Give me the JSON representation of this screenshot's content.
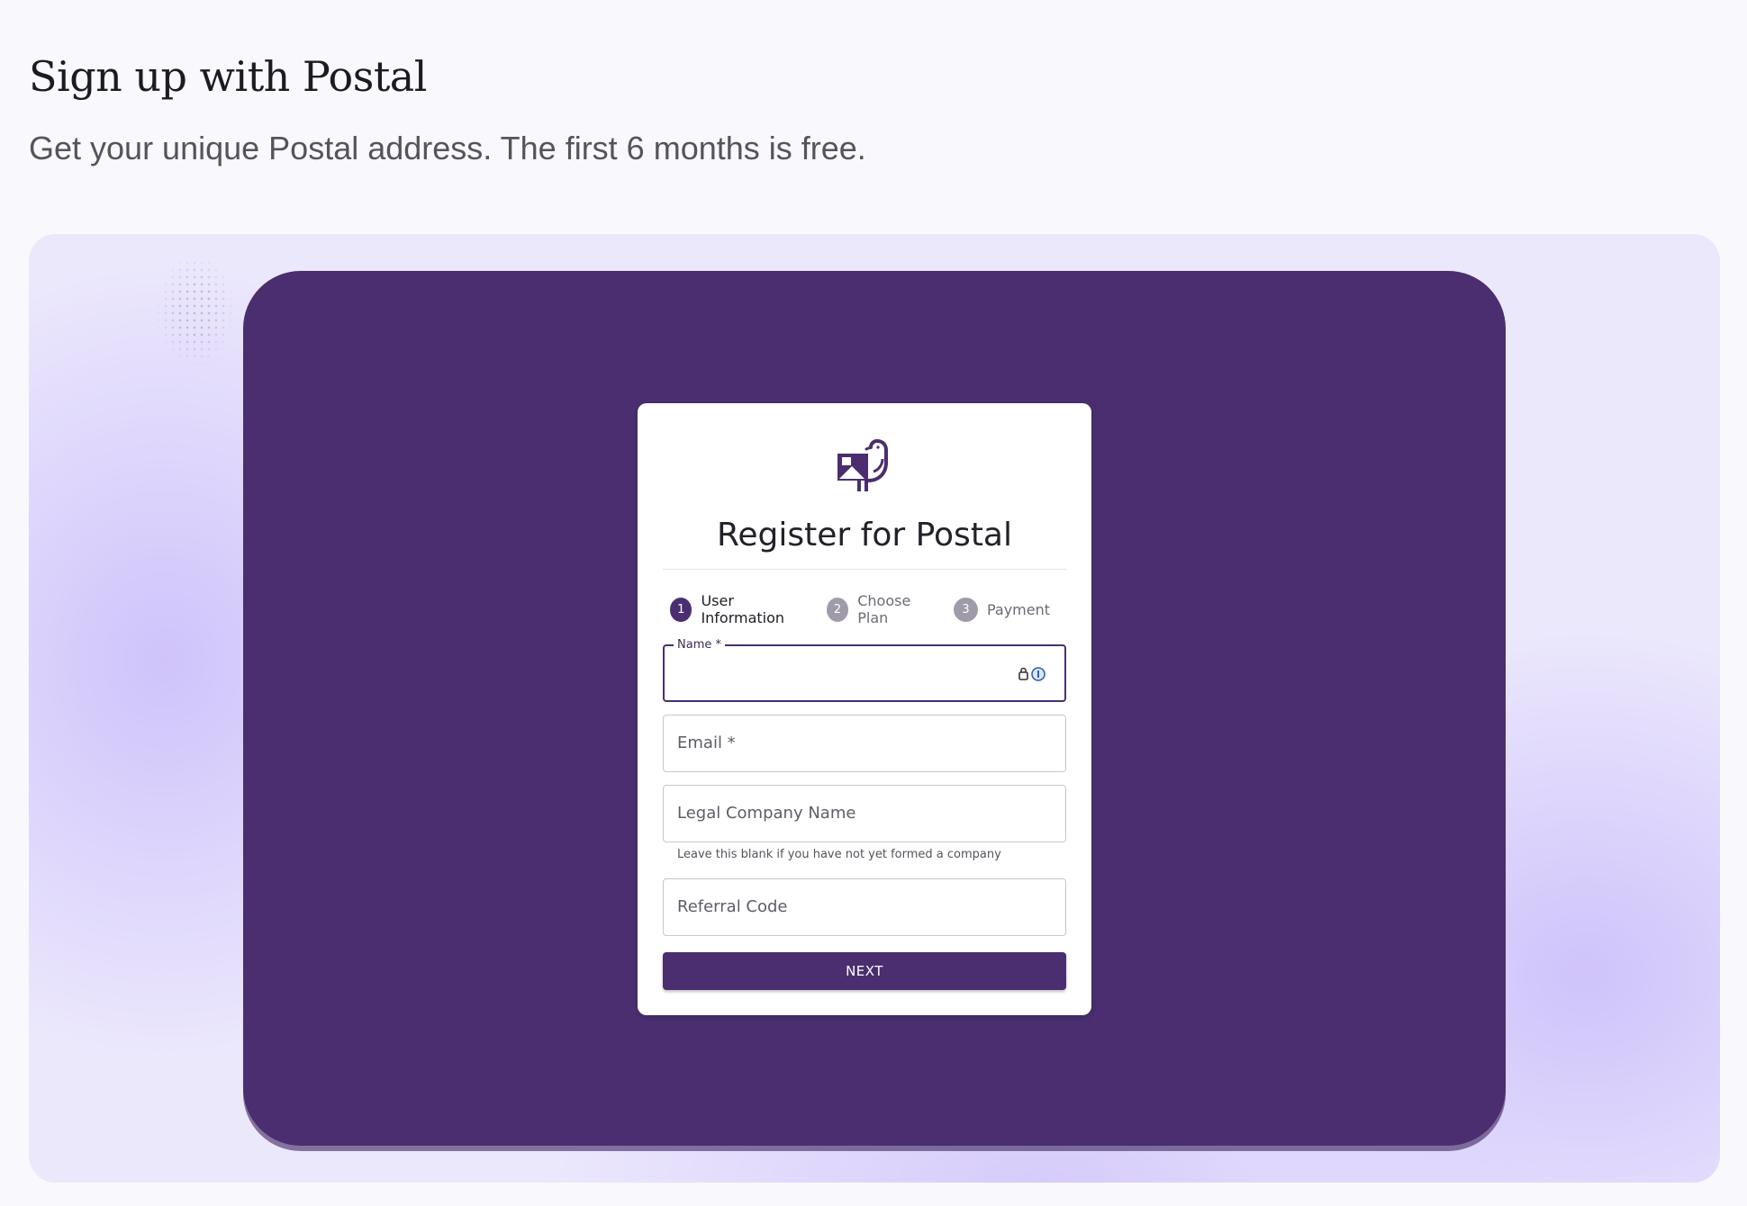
{
  "page": {
    "title": "Sign up with Postal",
    "subtitle": "Get your unique Postal address. The first 6 months is free."
  },
  "card": {
    "logo_icon": "postal-bird-envelope-icon",
    "title": "Register for Postal",
    "steps": [
      {
        "number": "1",
        "label": "User Information",
        "active": true
      },
      {
        "number": "2",
        "label": "Choose Plan",
        "active": false
      },
      {
        "number": "3",
        "label": "Payment",
        "active": false
      }
    ],
    "fields": {
      "name": {
        "label": "Name *",
        "value": ""
      },
      "email": {
        "placeholder": "Email *"
      },
      "company": {
        "placeholder": "Legal Company Name",
        "helper": "Leave this blank if you have not yet formed a company"
      },
      "referral": {
        "placeholder": "Referral Code"
      }
    },
    "next_label": "NEXT"
  },
  "colors": {
    "brand": "#4a2e70",
    "inactive_step": "#9f9ba8",
    "hero_background": "#ece8fc",
    "page_background": "#f9f8fd"
  }
}
